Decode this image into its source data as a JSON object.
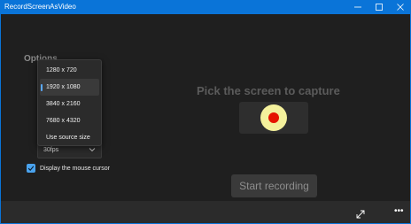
{
  "window": {
    "title": "RecordScreenAsVideo",
    "minimize_icon": "minimize-icon",
    "maximize_icon": "maximize-icon",
    "close_icon": "close-icon"
  },
  "options": {
    "heading": "Options",
    "resolution_dropdown": {
      "items": [
        "1280 x 720",
        "1920 x 1080",
        "3840 x 2160",
        "7680 x 4320",
        "Use source size"
      ],
      "selected": "1920 x 1080"
    },
    "framerate": {
      "value": "30fps"
    },
    "show_cursor": {
      "label": "Display the mouse cursor",
      "checked": true
    }
  },
  "main": {
    "pick_heading": "Pick the screen to capture",
    "start_label": "Start recording"
  },
  "appbar": {
    "expand_icon": "expand-icon",
    "more_icon": "more-icon",
    "more_glyph": "•••"
  },
  "colors": {
    "titlebar": "#0a74d8",
    "background": "#1f1f1f",
    "accent": "#4aa3ee",
    "record_outer": "#f4f19c",
    "record_inner": "#e51400"
  }
}
